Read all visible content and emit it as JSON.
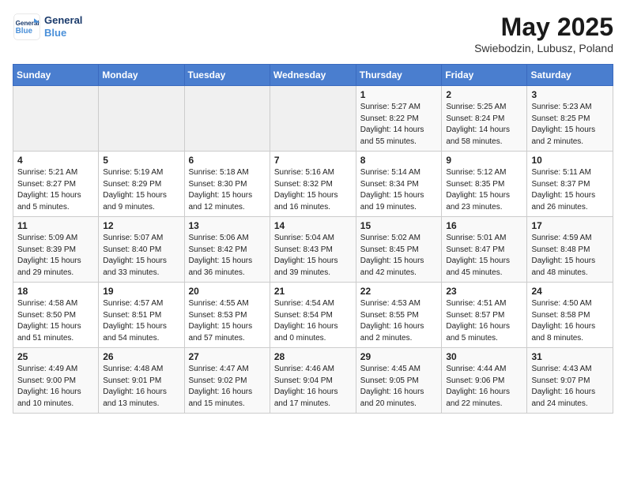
{
  "header": {
    "logo_general": "General",
    "logo_blue": "Blue",
    "month_title": "May 2025",
    "location": "Swiebodzin, Lubusz, Poland"
  },
  "weekdays": [
    "Sunday",
    "Monday",
    "Tuesday",
    "Wednesday",
    "Thursday",
    "Friday",
    "Saturday"
  ],
  "weeks": [
    [
      {
        "day": "",
        "empty": true
      },
      {
        "day": "",
        "empty": true
      },
      {
        "day": "",
        "empty": true
      },
      {
        "day": "",
        "empty": true
      },
      {
        "day": "1",
        "sunrise": "5:27 AM",
        "sunset": "8:22 PM",
        "daylight": "14 hours and 55 minutes."
      },
      {
        "day": "2",
        "sunrise": "5:25 AM",
        "sunset": "8:24 PM",
        "daylight": "14 hours and 58 minutes."
      },
      {
        "day": "3",
        "sunrise": "5:23 AM",
        "sunset": "8:25 PM",
        "daylight": "15 hours and 2 minutes."
      }
    ],
    [
      {
        "day": "4",
        "sunrise": "5:21 AM",
        "sunset": "8:27 PM",
        "daylight": "15 hours and 5 minutes."
      },
      {
        "day": "5",
        "sunrise": "5:19 AM",
        "sunset": "8:29 PM",
        "daylight": "15 hours and 9 minutes."
      },
      {
        "day": "6",
        "sunrise": "5:18 AM",
        "sunset": "8:30 PM",
        "daylight": "15 hours and 12 minutes."
      },
      {
        "day": "7",
        "sunrise": "5:16 AM",
        "sunset": "8:32 PM",
        "daylight": "15 hours and 16 minutes."
      },
      {
        "day": "8",
        "sunrise": "5:14 AM",
        "sunset": "8:34 PM",
        "daylight": "15 hours and 19 minutes."
      },
      {
        "day": "9",
        "sunrise": "5:12 AM",
        "sunset": "8:35 PM",
        "daylight": "15 hours and 23 minutes."
      },
      {
        "day": "10",
        "sunrise": "5:11 AM",
        "sunset": "8:37 PM",
        "daylight": "15 hours and 26 minutes."
      }
    ],
    [
      {
        "day": "11",
        "sunrise": "5:09 AM",
        "sunset": "8:39 PM",
        "daylight": "15 hours and 29 minutes."
      },
      {
        "day": "12",
        "sunrise": "5:07 AM",
        "sunset": "8:40 PM",
        "daylight": "15 hours and 33 minutes."
      },
      {
        "day": "13",
        "sunrise": "5:06 AM",
        "sunset": "8:42 PM",
        "daylight": "15 hours and 36 minutes."
      },
      {
        "day": "14",
        "sunrise": "5:04 AM",
        "sunset": "8:43 PM",
        "daylight": "15 hours and 39 minutes."
      },
      {
        "day": "15",
        "sunrise": "5:02 AM",
        "sunset": "8:45 PM",
        "daylight": "15 hours and 42 minutes."
      },
      {
        "day": "16",
        "sunrise": "5:01 AM",
        "sunset": "8:47 PM",
        "daylight": "15 hours and 45 minutes."
      },
      {
        "day": "17",
        "sunrise": "4:59 AM",
        "sunset": "8:48 PM",
        "daylight": "15 hours and 48 minutes."
      }
    ],
    [
      {
        "day": "18",
        "sunrise": "4:58 AM",
        "sunset": "8:50 PM",
        "daylight": "15 hours and 51 minutes."
      },
      {
        "day": "19",
        "sunrise": "4:57 AM",
        "sunset": "8:51 PM",
        "daylight": "15 hours and 54 minutes."
      },
      {
        "day": "20",
        "sunrise": "4:55 AM",
        "sunset": "8:53 PM",
        "daylight": "15 hours and 57 minutes."
      },
      {
        "day": "21",
        "sunrise": "4:54 AM",
        "sunset": "8:54 PM",
        "daylight": "16 hours and 0 minutes."
      },
      {
        "day": "22",
        "sunrise": "4:53 AM",
        "sunset": "8:55 PM",
        "daylight": "16 hours and 2 minutes."
      },
      {
        "day": "23",
        "sunrise": "4:51 AM",
        "sunset": "8:57 PM",
        "daylight": "16 hours and 5 minutes."
      },
      {
        "day": "24",
        "sunrise": "4:50 AM",
        "sunset": "8:58 PM",
        "daylight": "16 hours and 8 minutes."
      }
    ],
    [
      {
        "day": "25",
        "sunrise": "4:49 AM",
        "sunset": "9:00 PM",
        "daylight": "16 hours and 10 minutes."
      },
      {
        "day": "26",
        "sunrise": "4:48 AM",
        "sunset": "9:01 PM",
        "daylight": "16 hours and 13 minutes."
      },
      {
        "day": "27",
        "sunrise": "4:47 AM",
        "sunset": "9:02 PM",
        "daylight": "16 hours and 15 minutes."
      },
      {
        "day": "28",
        "sunrise": "4:46 AM",
        "sunset": "9:04 PM",
        "daylight": "16 hours and 17 minutes."
      },
      {
        "day": "29",
        "sunrise": "4:45 AM",
        "sunset": "9:05 PM",
        "daylight": "16 hours and 20 minutes."
      },
      {
        "day": "30",
        "sunrise": "4:44 AM",
        "sunset": "9:06 PM",
        "daylight": "16 hours and 22 minutes."
      },
      {
        "day": "31",
        "sunrise": "4:43 AM",
        "sunset": "9:07 PM",
        "daylight": "16 hours and 24 minutes."
      }
    ]
  ],
  "labels": {
    "sunrise": "Sunrise:",
    "sunset": "Sunset:",
    "daylight": "Daylight hours"
  }
}
